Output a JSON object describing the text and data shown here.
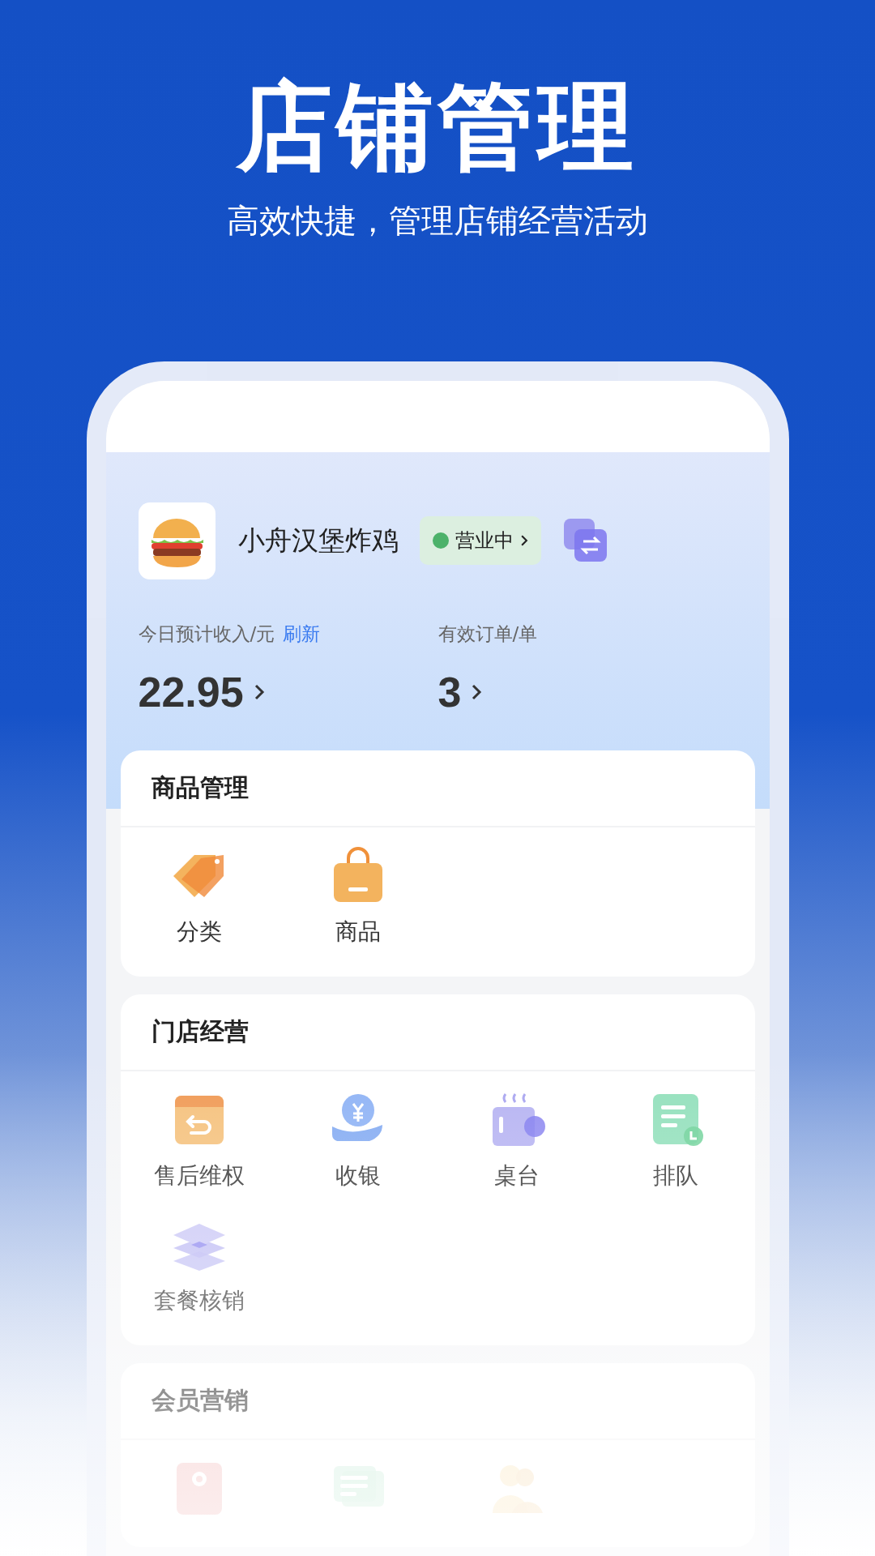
{
  "headline": "店铺管理",
  "subtitle": "高效快捷，管理店铺经营活动",
  "store": {
    "name": "小舟汉堡炸鸡",
    "status": "营业中",
    "color": "#4cb26a"
  },
  "stats": [
    {
      "label": "今日预计收入/元",
      "link": "刷新",
      "value": "22.95"
    },
    {
      "label": "有效订单/单",
      "value": "3"
    }
  ],
  "sections": [
    {
      "title": "商品管理",
      "items": [
        {
          "kind": "tags",
          "label": "分类"
        },
        {
          "kind": "bag",
          "label": "商品"
        }
      ]
    },
    {
      "title": "门店经营",
      "items": [
        {
          "kind": "return-box",
          "label": "售后维权"
        },
        {
          "kind": "coin-hand",
          "label": "收银"
        },
        {
          "kind": "mug",
          "label": "桌台"
        },
        {
          "kind": "receipt",
          "label": "排队"
        },
        {
          "kind": "layers",
          "label": "套餐核销"
        }
      ]
    },
    {
      "title": "会员营销",
      "items": [
        {
          "kind": "wallet"
        },
        {
          "kind": "chat"
        },
        {
          "kind": "people"
        }
      ]
    }
  ]
}
